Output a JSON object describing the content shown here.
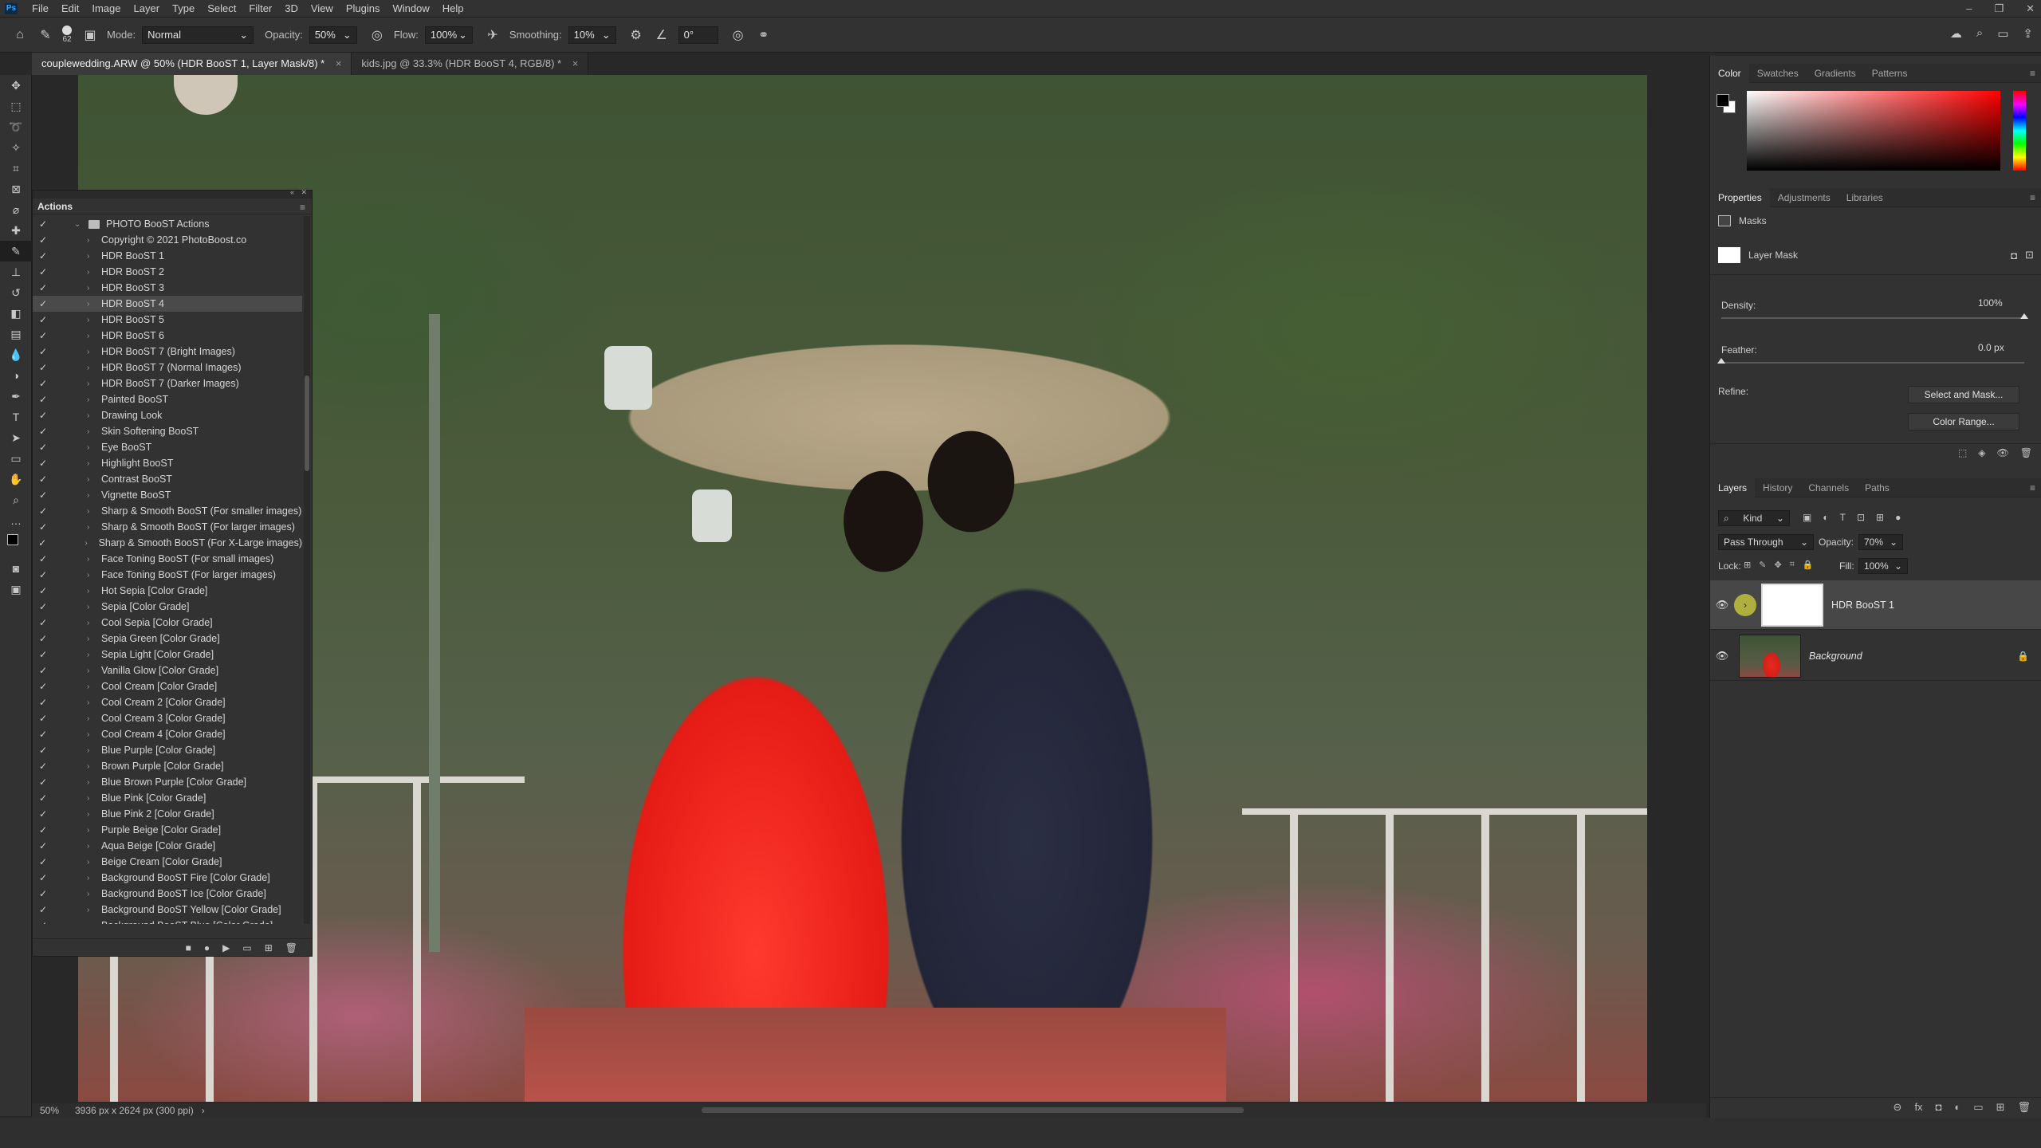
{
  "menubar": {
    "logo": "Ps",
    "items": [
      "File",
      "Edit",
      "Image",
      "Layer",
      "Type",
      "Select",
      "Filter",
      "3D",
      "View",
      "Plugins",
      "Window",
      "Help"
    ],
    "window_controls": [
      "–",
      "❐",
      "✕"
    ]
  },
  "options": {
    "brush_size": "62",
    "mode_label": "Mode:",
    "mode_value": "Normal",
    "opacity_label": "Opacity:",
    "opacity_value": "50%",
    "flow_label": "Flow:",
    "flow_value": "100%",
    "smoothing_label": "Smoothing:",
    "smoothing_value": "10%",
    "angle_value": "0°"
  },
  "tabs": [
    {
      "label": "couplewedding.ARW @ 50% (HDR BooST 1, Layer Mask/8) *",
      "close": "×"
    },
    {
      "label": "kids.jpg @ 33.3% (HDR BooST 4, RGB/8) *",
      "close": "×"
    }
  ],
  "actions": {
    "title": "Actions",
    "set_name": "PHOTO BooST Actions",
    "items": [
      "Copyright © 2021 PhotoBoost.co",
      "HDR BooST 1",
      "HDR BooST 2",
      "HDR BooST 3",
      "HDR BooST 4",
      "HDR BooST 5",
      "HDR BooST 6",
      "HDR BooST 7 (Bright Images)",
      "HDR BooST 7 (Normal Images)",
      "HDR BooST 7 (Darker Images)",
      "Painted BooST",
      "Drawing Look",
      "Skin Softening BooST",
      "Eye BooST",
      "Highlight BooST",
      "Contrast BooST",
      "Vignette BooST",
      "Sharp & Smooth BooST (For smaller images)",
      "Sharp & Smooth BooST (For larger images)",
      "Sharp & Smooth BooST (For X-Large images)",
      "Face Toning BooST (For small images)",
      "Face Toning BooST (For larger images)",
      "Hot Sepia [Color Grade]",
      "Sepia [Color Grade]",
      "Cool Sepia [Color Grade]",
      "Sepia Green [Color Grade]",
      "Sepia Light [Color Grade]",
      "Vanilla Glow [Color Grade]",
      "Cool Cream [Color Grade]",
      "Cool Cream 2 [Color Grade]",
      "Cool Cream 3 [Color Grade]",
      "Cool Cream 4 [Color Grade]",
      "Blue Purple [Color Grade]",
      "Brown Purple [Color Grade]",
      "Blue Brown Purple [Color Grade]",
      "Blue Pink [Color Grade]",
      "Blue Pink 2 [Color Grade]",
      "Purple Beige [Color Grade]",
      "Aqua Beige [Color Grade]",
      "Beige Cream [Color Grade]",
      "Background BooST Fire [Color Grade]",
      "Background BooST Ice [Color Grade]",
      "Background BooST Yellow [Color Grade]",
      "Background BooST Blue [Color Grade]"
    ],
    "selected_item": "HDR BooST 4",
    "footer_icons": [
      "■",
      "●",
      "▶",
      "▭",
      "⊞",
      "🗑"
    ]
  },
  "status": {
    "zoom": "50%",
    "doc_info": "3936 px x 2624 px (300 ppi)",
    "arrow": "›"
  },
  "color_panel": {
    "tabs": [
      "Color",
      "Swatches",
      "Gradients",
      "Patterns"
    ],
    "active": "Color",
    "foreground": "#000000",
    "background": "#ffffff"
  },
  "properties": {
    "tabs": [
      "Properties",
      "Adjustments",
      "Libraries"
    ],
    "active": "Properties",
    "section": "Masks",
    "mask_type": "Layer Mask",
    "density_label": "Density:",
    "density_value": "100%",
    "density": 1.0,
    "feather_label": "Feather:",
    "feather_value": "0.0 px",
    "feather": 0.0,
    "refine_label": "Refine:",
    "select_mask_button": "Select and Mask...",
    "color_range_button": "Color Range..."
  },
  "layers": {
    "tabs": [
      "Layers",
      "History",
      "Channels",
      "Paths"
    ],
    "active": "Layers",
    "filter_kind": "Kind",
    "blend_mode": "Pass Through",
    "opacity_label": "Opacity:",
    "opacity_value": "70%",
    "lock_label": "Lock:",
    "fill_label": "Fill:",
    "fill_value": "100%",
    "rows": [
      {
        "name": "HDR BooST 1"
      },
      {
        "name": "Background"
      }
    ],
    "footer_icons": [
      "⊖",
      "fx",
      "◘",
      "◐",
      "▭",
      "⊞",
      "🗑"
    ]
  }
}
